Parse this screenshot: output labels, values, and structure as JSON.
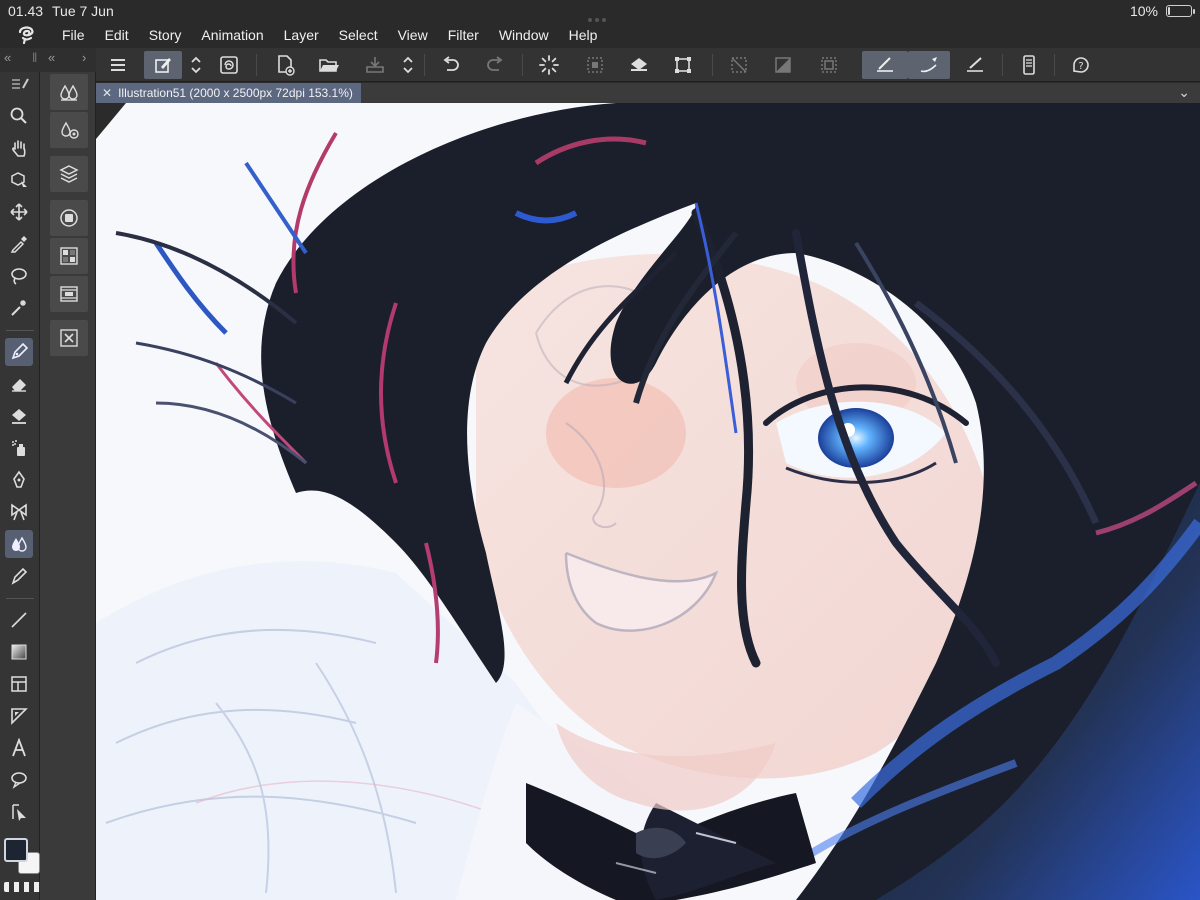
{
  "status_bar": {
    "time": "01.43",
    "date": "Tue 7 Jun",
    "battery_text": "10%",
    "battery_level": 0.1
  },
  "menu": {
    "items": [
      "File",
      "Edit",
      "Story",
      "Animation",
      "Layer",
      "Select",
      "View",
      "Filter",
      "Window",
      "Help"
    ]
  },
  "document": {
    "tab_title": "Illustration51 (2000 x 2500px 72dpi 153.1%)"
  },
  "colors": {
    "main_color": "#1e2532",
    "sub_color": "#f5f5f5",
    "accent": "#5c6780"
  },
  "toolbar": {
    "icons": [
      "menu-icon",
      "edit-icon",
      "up-down-icon",
      "spiral-icon",
      "new-canvas-icon",
      "open-folder-icon",
      "save-icon",
      "up-down-icon",
      "undo-icon",
      "redo-icon",
      "loading-icon",
      "select-area-icon",
      "fill-icon",
      "transform-icon",
      "clear-icon",
      "clear-outside-icon",
      "crop-icon",
      "correct-line-icon",
      "brush-stroke-icon",
      "ruler-icon",
      "device-icon",
      "help-icon"
    ]
  },
  "tools": {
    "items": [
      "zoom-tool-icon",
      "hand-tool-icon",
      "operation-tool-icon",
      "move-tool-icon",
      "eyedropper-tool-icon",
      "lasso-tool-icon",
      "magic-wand-tool-icon",
      "pen-tool-icon",
      "eraser-tool-icon",
      "fill-bucket-tool-icon",
      "airbrush-tool-icon",
      "vector-pen-tool-icon",
      "decoration-tool-icon",
      "blend-tool-icon",
      "correct-line-tool-icon",
      "line-tool-icon",
      "gradient-tool-icon",
      "frame-tool-icon",
      "ruler-tool-icon",
      "text-tool-icon",
      "balloon-tool-icon",
      "selection-arrow-tool-icon"
    ]
  }
}
